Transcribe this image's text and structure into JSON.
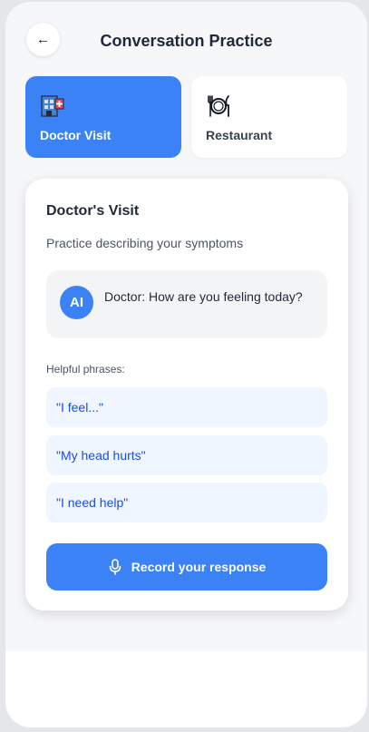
{
  "header": {
    "back_icon": "←",
    "title": "Conversation Practice"
  },
  "tabs": [
    {
      "label": "Doctor Visit",
      "icon": "hospital-icon",
      "active": true
    },
    {
      "label": "Restaurant",
      "icon": "plate-cutlery-icon",
      "active": false
    }
  ],
  "scenario": {
    "title": "Doctor's Visit",
    "subtitle": "Practice describing your symptoms",
    "ai_avatar_text": "AI",
    "ai_message": "Doctor: How are you feeling today?"
  },
  "phrases": {
    "label": "Helpful phrases:",
    "items": [
      "\"I feel...\"",
      "\"My head hurts\"",
      "\"I need help\""
    ]
  },
  "record": {
    "label": "Record your response",
    "icon": "microphone-icon"
  },
  "colors": {
    "accent": "#3b82f6",
    "phrase_bg": "#eff6ff",
    "phrase_text": "#1d4ed8",
    "screen_bg": "#f6f7f9"
  }
}
